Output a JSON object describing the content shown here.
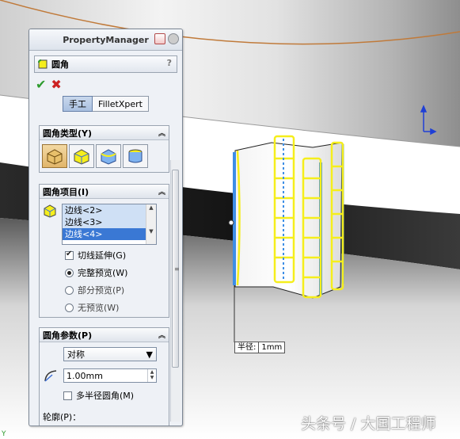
{
  "property_manager": {
    "title": "PropertyManager",
    "feature_name": "圆角",
    "help": "?",
    "ok_symbol": "✔",
    "cancel_symbol": "✖",
    "tabs": [
      {
        "label": "手工",
        "active": true
      },
      {
        "label": "FilletXpert",
        "active": false
      }
    ]
  },
  "fillet_type": {
    "title": "圆角类型(Y)"
  },
  "fillet_items": {
    "title": "圆角项目(I)",
    "edges": [
      "边线<2>",
      "边线<3>",
      "边线<4>"
    ],
    "selected_index": 2,
    "tangent_propagation": "切线延伸(G)",
    "preview_full": "完整预览(W)",
    "preview_partial": "部分预览(P)",
    "preview_none": "无预览(W)"
  },
  "fillet_params": {
    "title": "圆角参数(P)",
    "mode": "对称",
    "radius": "1.00mm",
    "multi_radius": "多半径圆角(M)",
    "profile": "轮廓(P)："
  },
  "viewport": {
    "radius_label": "半径:",
    "radius_value": "1mm"
  },
  "watermark": "头条号 / 大国工程师",
  "colors": {
    "accent_yellow": "#f5ee1c",
    "edge_blue": "#3d8ee6",
    "outline_orange": "#c07a3a"
  }
}
